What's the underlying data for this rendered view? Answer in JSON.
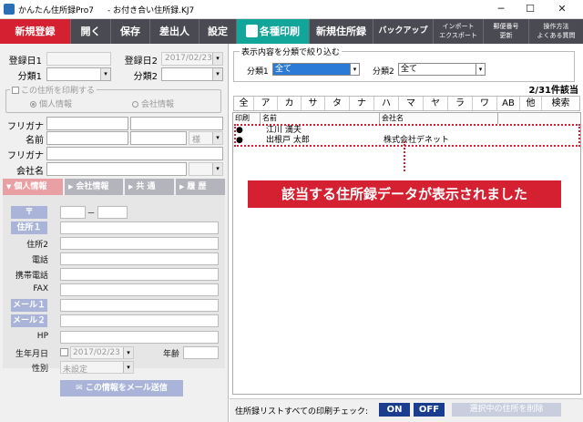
{
  "window": {
    "app_title": "かんたん住所録Pro7",
    "file_title": "- お付き合い住所録.KJ7",
    "minimize": "─",
    "maximize": "☐",
    "close": "✕"
  },
  "toolbar": {
    "new_reg": "新規登録",
    "open": "開く",
    "save": "保存",
    "sender": "差出人",
    "settings": "設定",
    "print": "各種印刷",
    "new_book": "新規住所録",
    "backup": "バックアップ",
    "import_top": "インポート",
    "import_bottom": "エクスポート",
    "postal_top": "郵便番号",
    "postal_bottom": "更新",
    "help_top": "操作方法",
    "help_bottom": "よくある質問"
  },
  "left": {
    "reg_date1": "登録日1",
    "reg_date2": "登録日2",
    "reg_date2_value": "2017/02/23",
    "cat1": "分類1",
    "cat2": "分類2",
    "print_group": "この住所を印刷する",
    "print_personal": "個人情報",
    "print_company": "会社情報",
    "furigana": "フリガナ",
    "name": "名前",
    "honorific": "様",
    "furigana2": "フリガナ",
    "company": "会社名",
    "tab_personal": "個人情報",
    "tab_company": "会社情報",
    "tab_common": "共 通",
    "tab_history": "履 歴",
    "zip": "〒",
    "zip_dash": "－",
    "addr1": "住所１",
    "addr2": "住所2",
    "phone": "電話",
    "mobile": "携帯電話",
    "fax": "FAX",
    "mail1": "メール１",
    "mail2": "メール２",
    "hp": "HP",
    "birthday": "生年月日",
    "birthday_value": "2017/02/23",
    "age": "年齢",
    "gender": "性別",
    "gender_value": "未設定",
    "send_mail": "この情報をメール送信"
  },
  "right": {
    "filter_title": "表示内容を分類で絞り込む",
    "filter1": "分類1",
    "filter1_value": "全て",
    "filter2": "分類2",
    "filter2_value": "全て",
    "count": "2/31件該当",
    "kana": [
      "全",
      "ア",
      "カ",
      "サ",
      "タ",
      "ナ",
      "ハ",
      "マ",
      "ヤ",
      "ラ",
      "ワ",
      "AB",
      "他",
      "検索"
    ],
    "columns": {
      "print": "印刷",
      "name": "名前",
      "company": "会社名"
    },
    "rows": [
      {
        "mark": "●",
        "name": "江川 満夫",
        "company": ""
      },
      {
        "mark": "●",
        "name": "出根戸 太郎",
        "company": "株式会社デネット"
      }
    ],
    "banner": "該当する住所録データが表示されました",
    "bottom_text": "住所録リストすべての印刷チェック:",
    "on": "ON",
    "off": "OFF",
    "delete": "選択中の住所を削除"
  },
  "colors": {
    "red": "#d42030",
    "teal": "#12a59a",
    "toolbar": "#4a4a52",
    "navy": "#1a3d8f",
    "pale_blue": "#a9b4d8"
  }
}
